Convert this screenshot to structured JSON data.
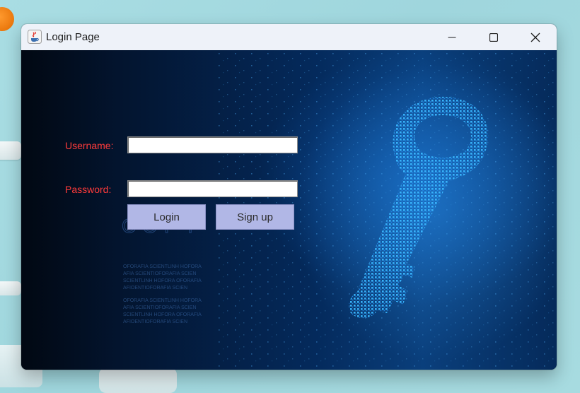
{
  "window": {
    "title": "Login Page",
    "app_icon": "java-icon",
    "controls": {
      "minimize_icon": "minimize-icon",
      "maximize_icon": "maximize-icon",
      "close_icon": "close-icon"
    }
  },
  "form": {
    "username_label": "Username:",
    "password_label": "Password:",
    "username_value": "",
    "password_value": "",
    "login_label": "Login",
    "signup_label": "Sign up"
  },
  "background": {
    "watermark_heading": "COPY",
    "watermark_lines": [
      "OFORAFIA SCIENTLINH HOFORA",
      "AFIA SCIENTIOFORAFIA SCIEN",
      "SCIENTLINH HOFORA OFORAFIA",
      "AFIOENTIOFORAFIA SCIEN",
      "OFORAFIA SCIENTLINH HOFORA",
      "AFIA SCIENTIOFORAFIA SCIEN",
      "SCIENTLINH HOFORA OFORAFIA",
      "AFIOENTIOFORAFIA SCIEN"
    ],
    "illustration": "digital-key"
  },
  "colors": {
    "label_red": "#ff3b3b",
    "button_fill": "#b1b7e6",
    "key_cyan": "#2aa6ff",
    "titlebar": "#eef2f9"
  }
}
